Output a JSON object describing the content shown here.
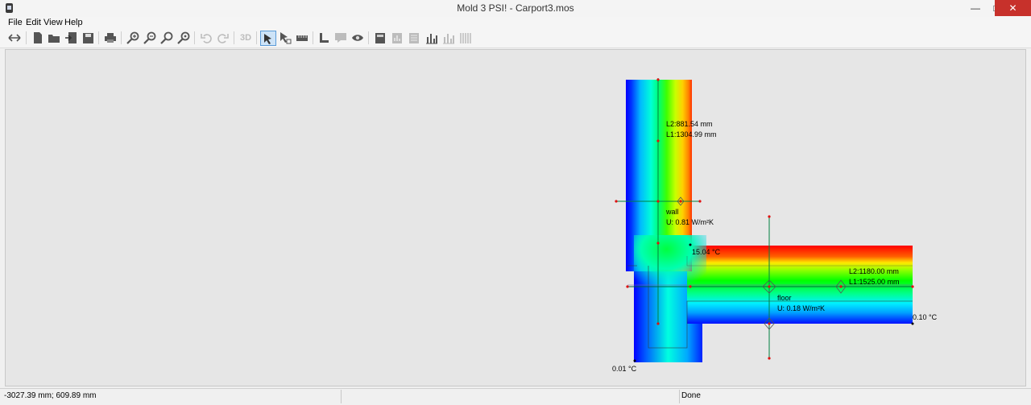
{
  "window": {
    "title": "Mold 3 PSI! - Carport3.mos",
    "minimize_glyph": "—",
    "maximize_glyph": "□",
    "close_glyph": "✕"
  },
  "menu": [
    "File",
    "Edit",
    "View",
    "Help"
  ],
  "toolbar": {
    "icons": [
      "swap-arrows-icon",
      "new-file-icon",
      "open-folder-icon",
      "import-icon",
      "save-icon",
      "print-icon",
      "zoom-in-icon",
      "zoom-out-icon",
      "zoom-fit-icon",
      "zoom-reset-icon",
      "undo-icon",
      "redo-icon",
      "3d-view-icon",
      "select-arrow-icon",
      "select-node-icon",
      "measure-icon",
      "l-shape-icon",
      "comment-icon",
      "eye-icon",
      "calc-icon",
      "chart-icon",
      "bars-icon",
      "histogram-icon",
      "sections-icon"
    ],
    "label_3d": "3D"
  },
  "drawing": {
    "wall_measure": {
      "l2": "L2:881.54 mm",
      "l1": "L1:1304.99 mm"
    },
    "wall": {
      "name": "wall",
      "u_value": "U: 0.81 W/m²K"
    },
    "floor_measure": {
      "l2": "L2:1180.00 mm",
      "l1": "L1:1525.00 mm"
    },
    "floor": {
      "name": "floor",
      "u_value": "U: 0.18 W/m²K"
    },
    "temps": {
      "inner": "15.04 °C",
      "right": "0.10 °C",
      "bottom": "0.01 °C"
    },
    "colors": {
      "cold": "#0000ff",
      "mid": "#00ff00",
      "warm": "#ff0000",
      "canvas": "#e6e6e6"
    }
  },
  "status": {
    "coords": "-3027.39 mm; 609.89 mm",
    "state": "Done"
  }
}
